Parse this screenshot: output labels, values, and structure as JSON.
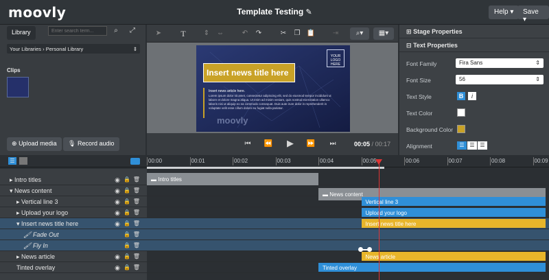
{
  "app": {
    "logo": "moovly",
    "title": "Template Testing",
    "help_label": "Help ▾",
    "save_label": "Save ▾"
  },
  "library": {
    "tab_label": "Library",
    "search_placeholder": "Enter search term...",
    "breadcrumb_root": "Your Libraries",
    "breadcrumb_sep": "›",
    "breadcrumb_current": "Personal Library",
    "clips_label": "Clips",
    "upload_label": "Upload media",
    "record_label": "Record audio"
  },
  "stage": {
    "title_text": "Insert news title here",
    "logo_text": "YOUR LOGO HERE",
    "article_heading": "Insert news article here.",
    "article_body": "Lorem ipsum dolor sit amet, consectetur adipiscing elit, sed do eiusmod tempor incididunt ut labore et dolore magna aliqua. Ut enim ad minim veniam, quis nostrud exercitation ullamco laboris nisi ut aliquip ex ea commodo consequat. Duis aute irure dolor in reprehenderit in voluptate velit esse cillum dolore eu fugiat nulla pariatur.",
    "watermark": "moovly"
  },
  "playback": {
    "current_time": "00:05",
    "separator": "/",
    "total_time": "00:17"
  },
  "properties": {
    "stage_header": "Stage Properties",
    "text_header": "Text Properties",
    "font_family_label": "Font Family",
    "font_family_value": "Fira Sans",
    "font_size_label": "Font Size",
    "font_size_value": "56",
    "text_style_label": "Text Style",
    "bold_label": "B",
    "italic_label": "i",
    "text_color_label": "Text Color",
    "text_color": "#ffffff",
    "bg_color_label": "Background Color",
    "bg_color": "#c9a227",
    "alignment_label": "Alignment"
  },
  "timeline": {
    "ticks": [
      "00:00",
      "00:01",
      "00:02",
      "00:03",
      "00:04",
      "00:05",
      "00:06",
      "00:07",
      "00:08",
      "00:09"
    ],
    "playhead_time_seconds": 5.4,
    "rows": [
      {
        "name": "Intro titles",
        "indent": 0,
        "arrow": "▸"
      },
      {
        "name": "News content",
        "indent": 0,
        "arrow": "▾"
      },
      {
        "name": "Vertical line 3",
        "indent": 1,
        "arrow": "▸"
      },
      {
        "name": "Upload your logo",
        "indent": 1,
        "arrow": "▸"
      },
      {
        "name": "Insert news title here",
        "indent": 1,
        "arrow": "▾"
      },
      {
        "name": "Fade Out",
        "indent": 2,
        "arrow": ""
      },
      {
        "name": "Fly In",
        "indent": 2,
        "arrow": ""
      },
      {
        "name": "News article",
        "indent": 1,
        "arrow": "▸"
      },
      {
        "name": "Tinted overlay",
        "indent": 1,
        "arrow": ""
      }
    ],
    "clips": [
      {
        "label": "Intro titles",
        "row": 0,
        "start": 0,
        "end": 4.0,
        "color": "#8a8f94",
        "folder": true
      },
      {
        "label": "News content",
        "row": 1,
        "start": 4.0,
        "end": 9.3,
        "color": "#8a8f94",
        "folder": true
      },
      {
        "label": "Vertical line 3",
        "row": 2,
        "start": 5.0,
        "end": 9.3,
        "color": "#2f8fd8",
        "folder": false
      },
      {
        "label": "Upload your logo",
        "row": 3,
        "start": 5.0,
        "end": 9.3,
        "color": "#2f8fd8",
        "folder": false
      },
      {
        "label": "Insert news title here",
        "row": 4,
        "start": 5.0,
        "end": 9.3,
        "color": "#e8b52a",
        "folder": false
      },
      {
        "label": "News article",
        "row": 7,
        "start": 5.0,
        "end": 9.3,
        "color": "#e8b52a",
        "folder": false
      },
      {
        "label": "Tinted overlay",
        "row": 8,
        "start": 4.0,
        "end": 9.3,
        "color": "#2f8fd8",
        "folder": false
      }
    ]
  }
}
